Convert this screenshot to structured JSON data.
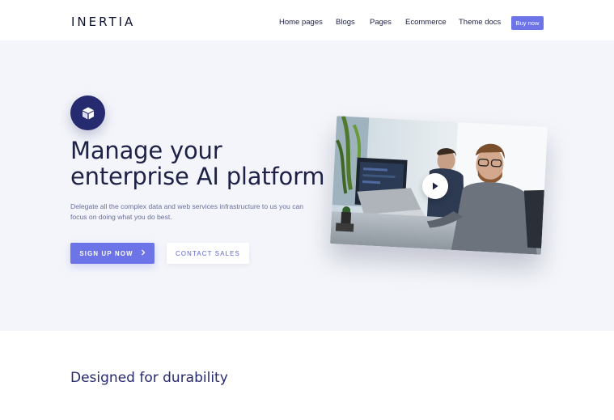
{
  "header": {
    "logo": "INERTIA",
    "nav": [
      "Home pages",
      "Blogs",
      "Pages",
      "Ecommerce",
      "Theme docs"
    ],
    "buy_label": "Buy now"
  },
  "hero": {
    "icon": "cube-icon",
    "title_line1": "Manage your",
    "title_line2": "enterprise AI platform",
    "subtitle": "Delegate all the complex data and web services infrastructure to us you can focus on doing what you do best.",
    "primary_button": "SIGN UP NOW",
    "secondary_button": "CONTACT SALES",
    "video": {
      "thumbnail": "office-workers-at-computers",
      "play_icon": "play-icon"
    }
  },
  "section": {
    "title": "Designed for durability"
  },
  "colors": {
    "accent": "#6c74e8",
    "navy": "#262a6e",
    "hero_bg": "#f3f5fa",
    "text": "#1e2246"
  }
}
